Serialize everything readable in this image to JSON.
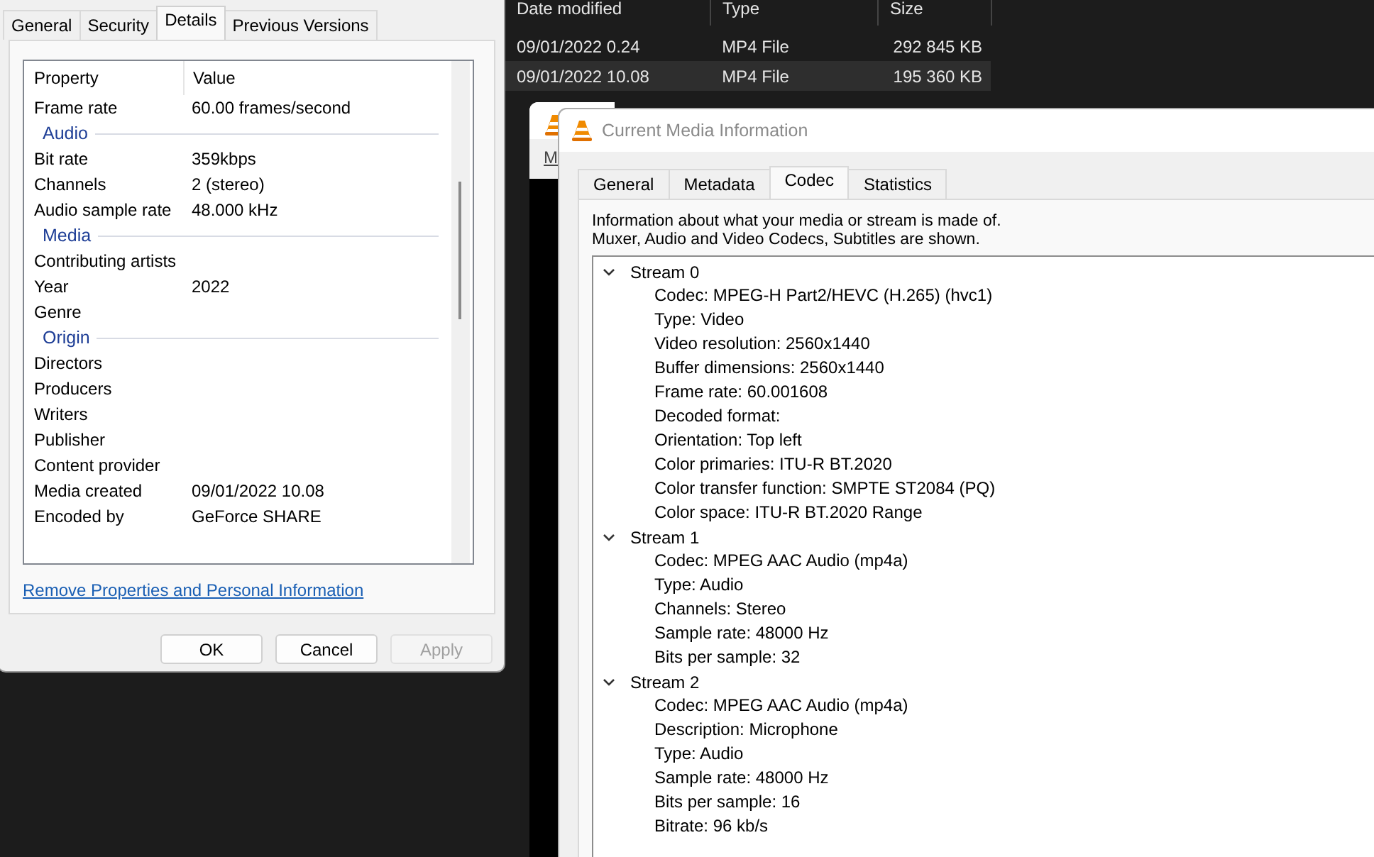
{
  "explorer": {
    "columns": [
      "Date modified",
      "Type",
      "Size"
    ],
    "rows": [
      {
        "date": "09/01/2022 0.24",
        "type": "MP4 File",
        "size": "292 845 KB",
        "selected": false
      },
      {
        "date": "09/01/2022 10.08",
        "type": "MP4 File",
        "size": "195 360 KB",
        "selected": true
      }
    ]
  },
  "properties_dialog": {
    "tabs": [
      {
        "label": "General",
        "selected": false
      },
      {
        "label": "Security",
        "selected": false
      },
      {
        "label": "Details",
        "selected": true
      },
      {
        "label": "Previous Versions",
        "selected": false
      }
    ],
    "columns": [
      "Property",
      "Value"
    ],
    "rows": [
      {
        "kind": "property",
        "name": "Frame rate",
        "value": "60.00 frames/second"
      },
      {
        "kind": "group",
        "name": "Audio"
      },
      {
        "kind": "property",
        "name": "Bit rate",
        "value": "359kbps"
      },
      {
        "kind": "property",
        "name": "Channels",
        "value": "2 (stereo)"
      },
      {
        "kind": "property",
        "name": "Audio sample rate",
        "value": "48.000 kHz"
      },
      {
        "kind": "group",
        "name": "Media"
      },
      {
        "kind": "property",
        "name": "Contributing artists"
      },
      {
        "kind": "property",
        "name": "Year",
        "value": "2022"
      },
      {
        "kind": "property",
        "name": "Genre"
      },
      {
        "kind": "group",
        "name": "Origin"
      },
      {
        "kind": "property",
        "name": "Directors"
      },
      {
        "kind": "property",
        "name": "Producers"
      },
      {
        "kind": "property",
        "name": "Writers"
      },
      {
        "kind": "property",
        "name": "Publisher"
      },
      {
        "kind": "property",
        "name": "Content provider"
      },
      {
        "kind": "property",
        "name": "Media created",
        "value": "09/01/2022 10.08"
      },
      {
        "kind": "property",
        "name": "Encoded by",
        "value": "GeForce SHARE"
      }
    ],
    "link": "Remove Properties and Personal Information",
    "buttons": [
      {
        "label": "OK",
        "disabled": false
      },
      {
        "label": "Cancel",
        "disabled": false
      },
      {
        "label": "Apply",
        "disabled": true
      }
    ]
  },
  "back_window": {
    "menu": "M"
  },
  "media_info": {
    "title": "Current Media Information",
    "tabs": [
      {
        "label": "General",
        "selected": false
      },
      {
        "label": "Metadata",
        "selected": false
      },
      {
        "label": "Codec",
        "selected": true
      },
      {
        "label": "Statistics",
        "selected": false
      }
    ],
    "description_lines": [
      "Information about what your media or stream is made of.",
      "Muxer, Audio and Video Codecs, Subtitles are shown."
    ],
    "streams": [
      {
        "name": "Stream 0",
        "expanded": true,
        "items": [
          "Codec: MPEG-H Part2/HEVC (H.265) (hvc1)",
          "Type: Video",
          "Video resolution: 2560x1440",
          "Buffer dimensions: 2560x1440",
          "Frame rate: 60.001608",
          "Decoded format:",
          "Orientation: Top left",
          "Color primaries: ITU-R BT.2020",
          "Color transfer function: SMPTE ST2084 (PQ)",
          "Color space: ITU-R BT.2020 Range"
        ]
      },
      {
        "name": "Stream 1",
        "expanded": true,
        "items": [
          "Codec: MPEG AAC Audio (mp4a)",
          "Type: Audio",
          "Channels: Stereo",
          "Sample rate: 48000 Hz",
          "Bits per sample: 32"
        ]
      },
      {
        "name": "Stream 2",
        "expanded": true,
        "items": [
          "Codec: MPEG AAC Audio (mp4a)",
          "Description: Microphone",
          "Type: Audio",
          "Sample rate: 48000 Hz",
          "Bits per sample: 16",
          "Bitrate: 96 kb/s"
        ]
      }
    ]
  }
}
